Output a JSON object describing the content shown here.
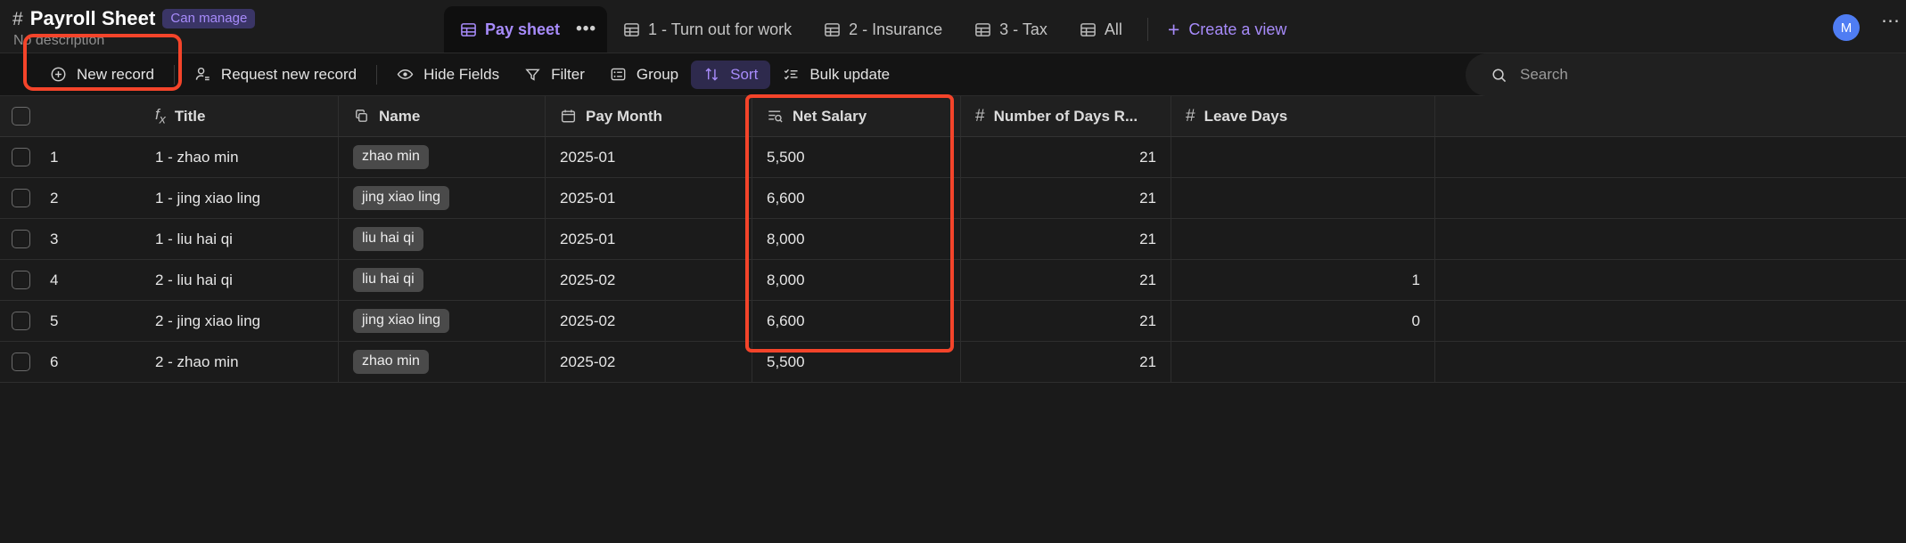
{
  "header": {
    "hash_icon": "hash-icon",
    "title": "Payroll Sheet",
    "permission_badge": "Can manage",
    "description": "No description",
    "avatar_initial": "M",
    "overflow": "⋯"
  },
  "view_tabs": [
    {
      "label": "Pay sheet",
      "active": true,
      "has_overflow": true,
      "overflow": "•••"
    },
    {
      "label": "1 - Turn out for work",
      "active": false
    },
    {
      "label": "2 - Insurance",
      "active": false
    },
    {
      "label": "3 - Tax",
      "active": false
    },
    {
      "label": "All",
      "active": false
    }
  ],
  "create_view": {
    "label": "Create a view",
    "icon": "plus-icon",
    "plus": "+"
  },
  "toolbar": {
    "items": [
      {
        "label": "New record",
        "icon": "plus-circle-icon",
        "active": false
      },
      {
        "label": "Request new record",
        "icon": "person-add-icon",
        "active": false
      },
      {
        "label": "Hide Fields",
        "icon": "eye-icon",
        "active": false
      },
      {
        "label": "Filter",
        "icon": "filter-icon",
        "active": false
      },
      {
        "label": "Group",
        "icon": "group-icon",
        "active": false
      },
      {
        "label": "Sort",
        "icon": "sort-icon",
        "active": true
      },
      {
        "label": "Bulk update",
        "icon": "bulk-update-icon",
        "active": false
      }
    ],
    "search_placeholder": "Search",
    "search_icon": "search-icon"
  },
  "grid": {
    "columns": [
      {
        "key": "title",
        "label": "Title",
        "icon": "formula-icon"
      },
      {
        "key": "name",
        "label": "Name",
        "icon": "link-record-icon"
      },
      {
        "key": "month",
        "label": "Pay Month",
        "icon": "calendar-icon"
      },
      {
        "key": "salary",
        "label": "Net Salary",
        "icon": "lookup-icon"
      },
      {
        "key": "days",
        "label": "Number of Days R...",
        "icon": "number-icon"
      },
      {
        "key": "leave",
        "label": "Leave Days",
        "icon": "number-icon"
      }
    ],
    "rows": [
      {
        "index": "1",
        "title": "1 - zhao min",
        "name": "zhao min",
        "month": "2025-01",
        "salary": "5,500",
        "days": "21",
        "leave": ""
      },
      {
        "index": "2",
        "title": "1 - jing xiao ling",
        "name": "jing xiao ling",
        "month": "2025-01",
        "salary": "6,600",
        "days": "21",
        "leave": ""
      },
      {
        "index": "3",
        "title": "1 - liu hai qi",
        "name": "liu hai qi",
        "month": "2025-01",
        "salary": "8,000",
        "days": "21",
        "leave": ""
      },
      {
        "index": "4",
        "title": "2 - liu hai qi",
        "name": "liu hai qi",
        "month": "2025-02",
        "salary": "8,000",
        "days": "21",
        "leave": "1"
      },
      {
        "index": "5",
        "title": "2 - jing xiao ling",
        "name": "jing xiao ling",
        "month": "2025-02",
        "salary": "6,600",
        "days": "21",
        "leave": "0"
      },
      {
        "index": "6",
        "title": "2 - zhao min",
        "name": "zhao min",
        "month": "2025-02",
        "salary": "5,500",
        "days": "21",
        "leave": ""
      }
    ]
  },
  "annotations": {
    "highlight_color": "#f4442a",
    "boxes": [
      {
        "target": "new-record-button"
      },
      {
        "target": "pay-month-column"
      }
    ]
  },
  "colors": {
    "accent_purple": "#a78bfa",
    "highlight_red": "#f4442a",
    "avatar_blue": "#4f7df3",
    "background": "#1a1a1a"
  }
}
